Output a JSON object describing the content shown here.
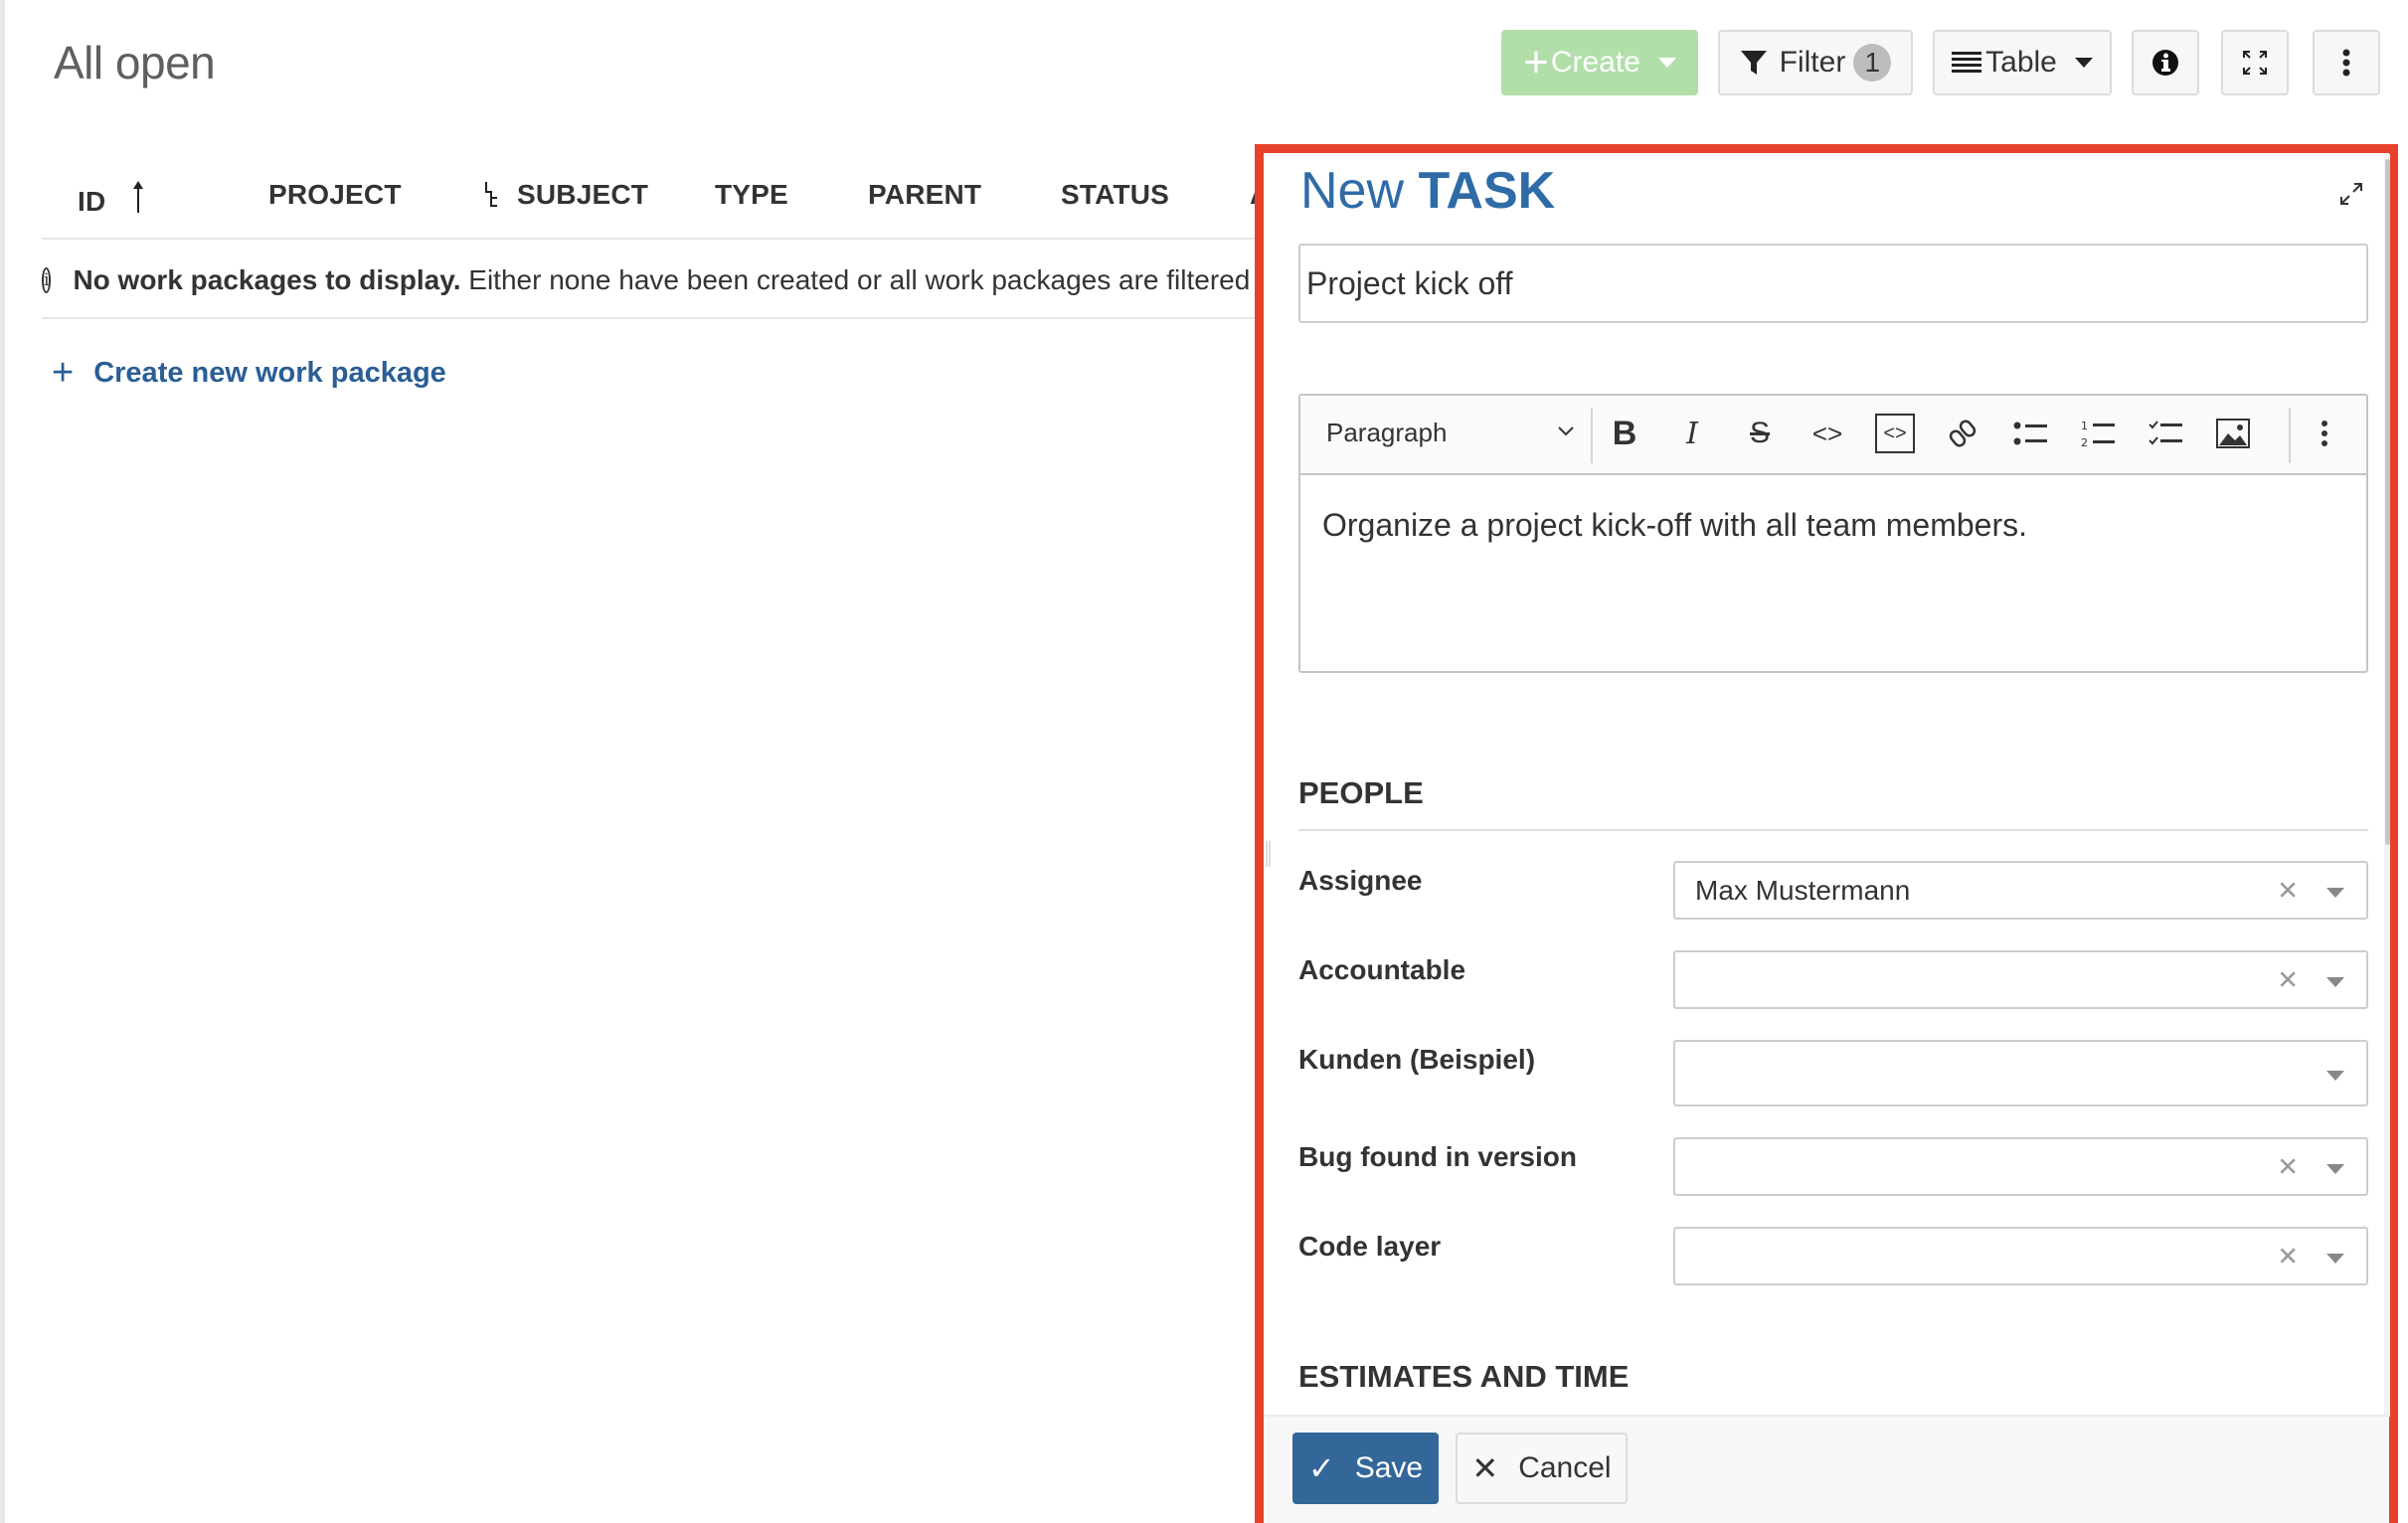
{
  "page": {
    "title": "All open"
  },
  "toolbar": {
    "create_label": "Create",
    "filter_label": "Filter",
    "filter_count": "1",
    "view_label": "Table",
    "info_icon": "info-icon",
    "fullscreen_icon": "fullscreen-icon",
    "more_icon": "more-vertical-icon"
  },
  "table": {
    "columns": [
      {
        "label": "ID",
        "sorted": "ascending"
      },
      {
        "label": "PROJECT"
      },
      {
        "label": "SUBJECT",
        "icon": "hierarchy-icon"
      },
      {
        "label": "TYPE"
      },
      {
        "label": "PARENT"
      },
      {
        "label": "STATUS"
      },
      {
        "label": "A"
      }
    ],
    "empty_message_bold": "No work packages to display.",
    "empty_message_rest": " Either none have been created or all work packages are filtered ou",
    "create_link": "Create new work package"
  },
  "panel": {
    "title_prefix": "New",
    "title_type": "TASK",
    "subject_value": "Project kick off",
    "editor": {
      "block_format": "Paragraph",
      "tools": [
        "bold",
        "italic",
        "strikethrough",
        "code",
        "code-block",
        "link",
        "bulleted-list",
        "numbered-list",
        "todo-list",
        "image",
        "more"
      ],
      "content": "Organize a project kick-off with all team members."
    },
    "sections": [
      {
        "title": "PEOPLE",
        "fields": [
          {
            "label": "Assignee",
            "value": "Max Mustermann",
            "clearable": true
          },
          {
            "label": "Accountable",
            "value": "",
            "clearable": true
          },
          {
            "label": "Kunden (Beispiel)",
            "value": "",
            "clearable": false
          },
          {
            "label": "Bug found in version",
            "value": "",
            "clearable": true
          },
          {
            "label": "Code layer",
            "value": "",
            "clearable": true
          }
        ]
      },
      {
        "title": "ESTIMATES AND TIME",
        "fields": []
      }
    ],
    "save_label": "Save",
    "cancel_label": "Cancel"
  },
  "colors": {
    "highlight_border": "#e8412b",
    "primary": "#336699",
    "title_blue": "#2f6ba7",
    "create_button": "#b2dfa9",
    "link": "#2a5e95"
  }
}
